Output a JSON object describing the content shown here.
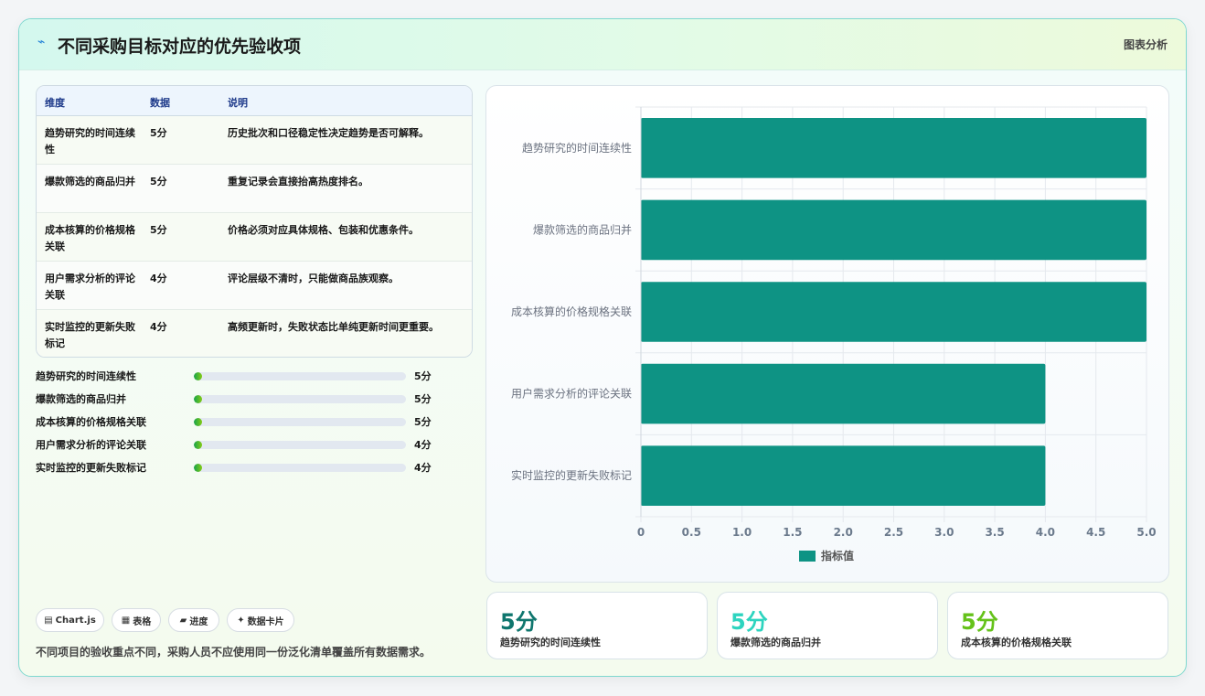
{
  "header": {
    "icon": "⌁",
    "title": "不同采购目标对应的优先验收项",
    "tag": "图表分析"
  },
  "table": {
    "headers": [
      "维度",
      "数据",
      "说明"
    ],
    "rows": [
      {
        "dimension": "趋势研究的时间连续性",
        "data": "5分",
        "desc": "历史批次和口径稳定性决定趋势是否可解释。"
      },
      {
        "dimension": "爆款筛选的商品归并",
        "data": "5分",
        "desc": "重复记录会直接抬高热度排名。"
      },
      {
        "dimension": "成本核算的价格规格关联",
        "data": "5分",
        "desc": "价格必须对应具体规格、包装和优惠条件。"
      },
      {
        "dimension": "用户需求分析的评论关联",
        "data": "4分",
        "desc": "评论层级不清时，只能做商品族观察。"
      },
      {
        "dimension": "实时监控的更新失败标记",
        "data": "4分",
        "desc": "高频更新时，失败状态比单纯更新时间更重要。"
      }
    ]
  },
  "progress": [
    {
      "label": "趋势研究的时间连续性",
      "value": "5分",
      "fraction": 0.04
    },
    {
      "label": "爆款筛选的商品归并",
      "value": "5分",
      "fraction": 0.04
    },
    {
      "label": "成本核算的价格规格关联",
      "value": "5分",
      "fraction": 0.04
    },
    {
      "label": "用户需求分析的评论关联",
      "value": "4分",
      "fraction": 0.04
    },
    {
      "label": "实时监控的更新失败标记",
      "value": "4分",
      "fraction": 0.04
    }
  ],
  "chips": [
    {
      "icon": "▤",
      "label": "Chart.js"
    },
    {
      "icon": "▦",
      "label": "表格"
    },
    {
      "icon": "▰",
      "label": "进度"
    },
    {
      "icon": "✦",
      "label": "数据卡片"
    }
  ],
  "footnote": "不同项目的验收重点不同，采购人员不应使用同一份泛化清单覆盖所有数据需求。",
  "stats": [
    {
      "value": "5分",
      "label": "趋势研究的时间连续性",
      "color": "#0f766e"
    },
    {
      "value": "5分",
      "label": "爆款筛选的商品归并",
      "color": "#2dd4bf"
    },
    {
      "value": "5分",
      "label": "成本核算的价格规格关联",
      "color": "#65c21a"
    }
  ],
  "chart_data": {
    "type": "bar",
    "orientation": "horizontal",
    "categories": [
      "趋势研究的时间连续性",
      "爆款筛选的商品归并",
      "成本核算的价格规格关联",
      "用户需求分析的评论关联",
      "实时监控的更新失败标记"
    ],
    "series": [
      {
        "name": "指标值",
        "values": [
          5,
          5,
          5,
          4,
          4
        ],
        "color": "#0e9384"
      }
    ],
    "xlim": [
      0,
      5
    ],
    "xticks": [
      "0",
      "0.5",
      "1.0",
      "1.5",
      "2.0",
      "2.5",
      "3.0",
      "3.5",
      "4.0",
      "4.5",
      "5.0"
    ],
    "grid": true,
    "legend": "bottom"
  }
}
